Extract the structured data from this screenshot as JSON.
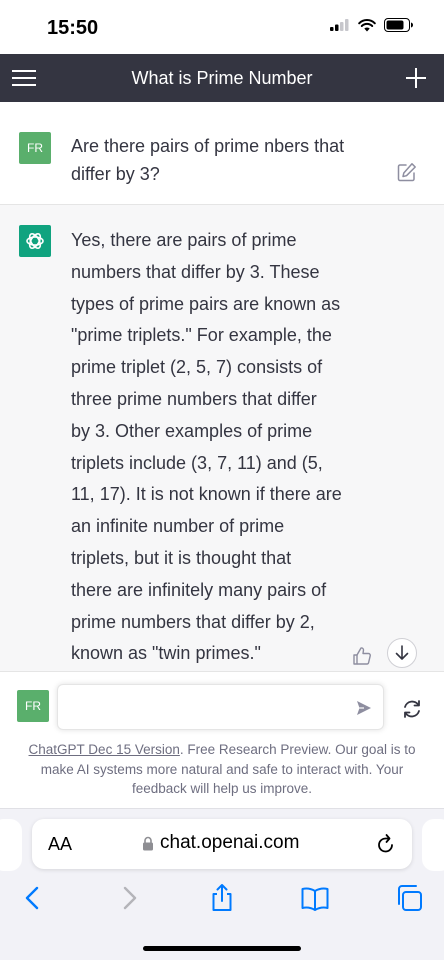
{
  "status": {
    "time": "15:50"
  },
  "header": {
    "title": "What is Prime Number"
  },
  "user_message": {
    "avatar": "FR",
    "text": "Are there pairs of prime nbers that differ by 3?"
  },
  "assistant_message": {
    "lines": [
      "Yes, there are pairs of prime",
      "numbers that differ by 3. These",
      "types of prime pairs are known as",
      "\"prime triplets.\" For example, the",
      "prime triplet (2, 5, 7) consists of",
      "three prime numbers that differ",
      "by 3. Other examples of prime",
      "triplets include (3, 7, 11) and (5,",
      "11, 17). It is not known if there are",
      "an infinite number of prime",
      "triplets, but it is thought that",
      "there are infinitely many pairs of",
      "prime numbers that differ by 2,",
      "known as \"twin primes.\""
    ]
  },
  "composer": {
    "avatar": "FR",
    "value": ""
  },
  "footer": {
    "link_text": "ChatGPT Dec 15 Version",
    "text": ". Free Research Preview. Our goal is to make AI systems more natural and safe to interact with. Your feedback will help us improve."
  },
  "browser": {
    "aa_label": "AA",
    "url": "chat.openai.com"
  },
  "colors": {
    "header_bg": "#343541",
    "user_avatar": "#5aaf6c",
    "gpt_avatar": "#10a37f",
    "assistant_bg": "#f7f7f8",
    "ios_blue": "#007aff"
  },
  "icons": [
    "menu-icon",
    "plus-icon",
    "edit-icon",
    "openai-logo-icon",
    "thumbs-up-icon",
    "arrow-down-icon",
    "send-icon",
    "regenerate-icon",
    "lock-icon",
    "reload-icon",
    "back-icon",
    "forward-icon",
    "share-icon",
    "bookmarks-icon",
    "tabs-icon",
    "signal-icon",
    "wifi-icon",
    "battery-icon"
  ]
}
